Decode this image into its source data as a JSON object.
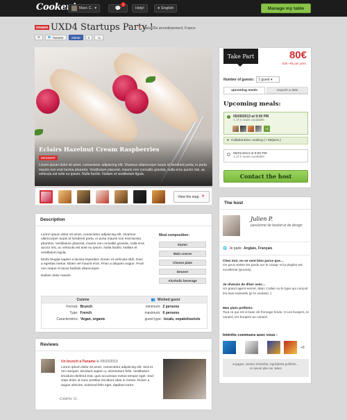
{
  "topbar": {
    "logo": "Cookening",
    "user": "Marc C.",
    "notif_count": "3",
    "help": "Help!",
    "lang": "English",
    "manage": "Manage my table"
  },
  "event": {
    "tag": "DINNER",
    "title": "UXD4 Startups Party !",
    "location": "Paris 20e arrondissement, France",
    "share": {
      "email": "✉",
      "tweet": "Tweeter",
      "fb": "J'aime",
      "fb_count": "0",
      "gplus": "+1"
    }
  },
  "photo": {
    "title": "Eclairs Hazelnut Cream Raspberries",
    "tag": "DESSERT",
    "desc": "Lorem ipsum dolor sit amet, consectetur adipiscing elit. Vivamus ullamcorper turpis id hendrerit porta, in porta mauris non erat lacinia pharetra. Vestibulum placerat, mauris non convallis gravida, nulla eros auctor nisi, ac vehicula est ante eu ipsum. Nulla facilisi. Nullam et vestibulum ligula.",
    "viewmap": "View the map"
  },
  "description": {
    "title": "Description",
    "p1": "Lorem ipsum dolor sit amet, consectetur adipiscing elit. Vivamus ullamcorper turpis id hendrerit porta, in porta mauris non erat lacinia pharetra. Vestibulum placerat, mauris non convallis gravida, nulla eros auctor nisi, ac vehicula est ante eu ipsum. Nulla facilisi. Nullam et vestibulum ligula.",
    "p2": "Morbi feugiat sapien a lacinia imperdiet. Donec et vehicula nibh. Duis a egestas metus. Etiam vel mauris eros. Proin a aliquam augue. Proin non neque et lacus facilisis ullamcorper.",
    "p3": "Nullam dolor mauris.",
    "comp_title": "Meal composition:",
    "comp": [
      "Starter",
      "Main course",
      "Cheese plate",
      "Dessert",
      "Alcoholic beverage"
    ],
    "cuisine_head": "Cuisine",
    "guest_head": "Wished guest",
    "format_k": "Format:",
    "format_v": "Brunch",
    "type_k": "Type:",
    "type_v": "French",
    "char_k": "Caracteristics:",
    "char_v": "Vegan, organic",
    "min_k": "minimum:",
    "min_v": "2 persons",
    "max_k": "maximum:",
    "max_v": "6 persons",
    "gtype_k": "guest type:",
    "gtype_v": "locals, expats/tourists"
  },
  "reviews": {
    "title": "Reviews",
    "link": "Un brunch à Paname",
    "date_prefix": "le",
    "date": "09/10/2013",
    "text": "Lorem ipsum dolor sit amet, consectetur adipiscing elit. Sed et orci semper, tincidunt sapien a, elementum felis. Vestibulum tincidunt eleifend erat, quis accumsan metus tempor eget. Sed vitae dolor ut nunc porttitor tincidunt vitae in metus. Donec a augue ultricies, euismod felis eget, dapibus tortor.",
    "sign": "Cédric G."
  },
  "booking": {
    "takepart": "Take Part",
    "price": "80€",
    "price_sub": "€35 +€5 per pers.",
    "guests_label": "Number of guests:",
    "guests_value": "1 guest",
    "tab_upcoming": "upcoming meals",
    "tab_request": "request a date",
    "upcoming_title": "Upcoming meals:",
    "meal1_date": "05/09/2013 at 9:00 PM",
    "meal1_seats": "1 of 5 seats available",
    "meal1_plus": "+1",
    "collab": "Collaborative cooking (+ €5/pers.)",
    "meal2_date": "06/01/2013 at 9:00 PM",
    "meal2_seats": "1 of 5 seats available",
    "contact": "Contact the host"
  },
  "host": {
    "title": "The host",
    "name": "Julien P.",
    "tagline": "passionné de basket et de design",
    "lang_prefix": "Je parle",
    "langs": "Anglais, Français",
    "q1": "Chez moi, on se sent bien parce que…",
    "a1": "On peut mettre les pieds sur le canap' et la playlist est excellente (promis).",
    "q2": "Je rêverais de dîner avec…",
    "a2": "Un grand agent-secret, Marc Cullan ou le type qui conçoit les lave-vaisselle (je le voulais) :)",
    "q3": "Mes plats préférés:",
    "a3": "Tout ce qui est à base de fromage fondu :3 Les burgers, le canard, les burgers au canard.",
    "int_title": "Intérêts communs avec vous :",
    "int_more": "+8",
    "int_foot1": "voyages, centres d'intérêts, ingrédients préférés…",
    "int_foot2": "en savoir plus sur Julien"
  }
}
